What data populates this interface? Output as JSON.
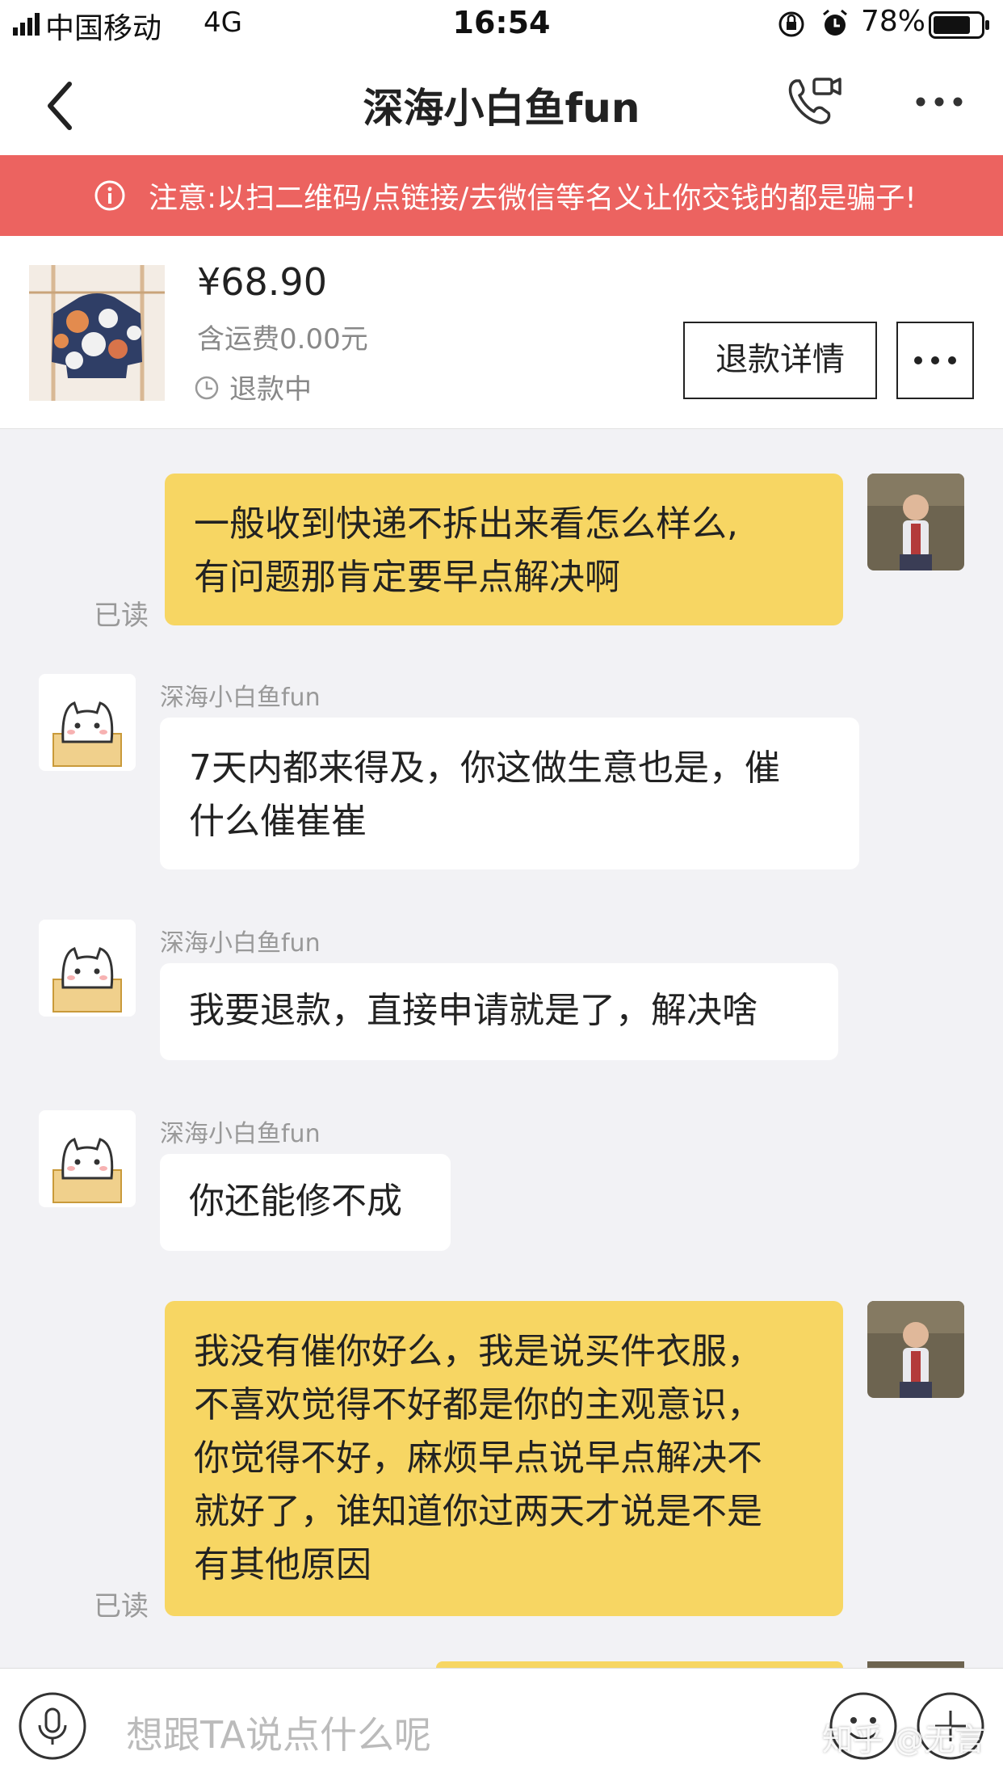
{
  "status_bar": {
    "carrier": "中国移动",
    "network": "4G",
    "time": "16:54",
    "battery": "78%",
    "battery_level": 0.78
  },
  "nav": {
    "title": "深海小白鱼fun",
    "icons": [
      "back-arrow-icon",
      "video-call-icon",
      "more-dots-icon"
    ]
  },
  "warning": {
    "text": "注意:以扫二维码/点链接/去微信等名义让你交钱的都是骗子!",
    "color": "#ec6360"
  },
  "product": {
    "price": "¥68.90",
    "shipping": "含运费0.00元",
    "status": "退款中",
    "refund_button": "退款详情"
  },
  "messages": [
    {
      "from": "me",
      "text_lines": [
        "一般收到快递不拆出来看怎么样么,",
        "有问题那肯定要早点解决啊"
      ],
      "read": "已读"
    },
    {
      "from": "them",
      "name": "深海小白鱼fun",
      "text_lines": [
        "7天内都来得及，你这做生意也是，催",
        "什么催崔崔"
      ]
    },
    {
      "from": "them",
      "name": "深海小白鱼fun",
      "text_lines": [
        "我要退款，直接申请就是了，解决啥"
      ]
    },
    {
      "from": "them",
      "name": "深海小白鱼fun",
      "text_lines": [
        "你还能修不成"
      ]
    },
    {
      "from": "me",
      "text_lines": [
        "我没有催你好么，我是说买件衣服，",
        "不喜欢觉得不好都是你的主观意识，",
        "你觉得不好，麻烦早点说早点解决不",
        "就好了，谁知道你过两天才说是不是",
        "有其他原因"
      ],
      "read": "已读"
    }
  ],
  "input_bar": {
    "placeholder": "想跟TA说点什么呢"
  },
  "watermark": "知乎 @无言",
  "colors": {
    "my_bubble": "#f7d663",
    "their_bubble": "#ffffff",
    "background": "#f2f2f5"
  }
}
